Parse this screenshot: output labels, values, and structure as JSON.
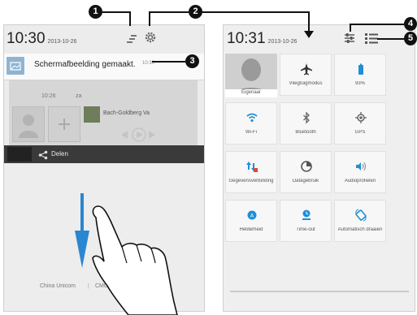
{
  "callouts": [
    "1",
    "2",
    "3",
    "4",
    "5"
  ],
  "left_screen": {
    "time": "10:30",
    "date": "2013-10-26",
    "notification": {
      "title": "Schermafbeelding gemaakt.",
      "time": "10:30"
    },
    "media": {
      "time": "10:26",
      "day": "za",
      "track": "Bach-Goldberg Va"
    },
    "share_label": "Delen",
    "carrier": "China Unicom",
    "carrier2": "CMC"
  },
  "right_screen": {
    "time": "10:31",
    "date": "2013-10-26",
    "owner_label": "Eigenaar",
    "tiles": [
      {
        "label": "Vliegtuigmodus",
        "icon": "airplane-icon"
      },
      {
        "label": "93%",
        "icon": "battery-icon"
      },
      {
        "label": "Wi-Fi",
        "icon": "wifi-icon"
      },
      {
        "label": "Bluetooth",
        "icon": "bluetooth-icon"
      },
      {
        "label": "GPS",
        "icon": "gps-icon"
      },
      {
        "label": "Gegevensverbinding",
        "icon": "data-connection-icon"
      },
      {
        "label": "Datagebruik",
        "icon": "data-usage-icon"
      },
      {
        "label": "Audioprofielen",
        "icon": "audio-profiles-icon"
      },
      {
        "label": "Helderheid",
        "icon": "brightness-icon"
      },
      {
        "label": "Time-out",
        "icon": "timeout-icon"
      },
      {
        "label": "Automatisch draaien",
        "icon": "auto-rotate-icon"
      }
    ]
  },
  "colors": {
    "accent": "#1f8fd6",
    "callout": "#111111",
    "panel": "#ececec"
  }
}
